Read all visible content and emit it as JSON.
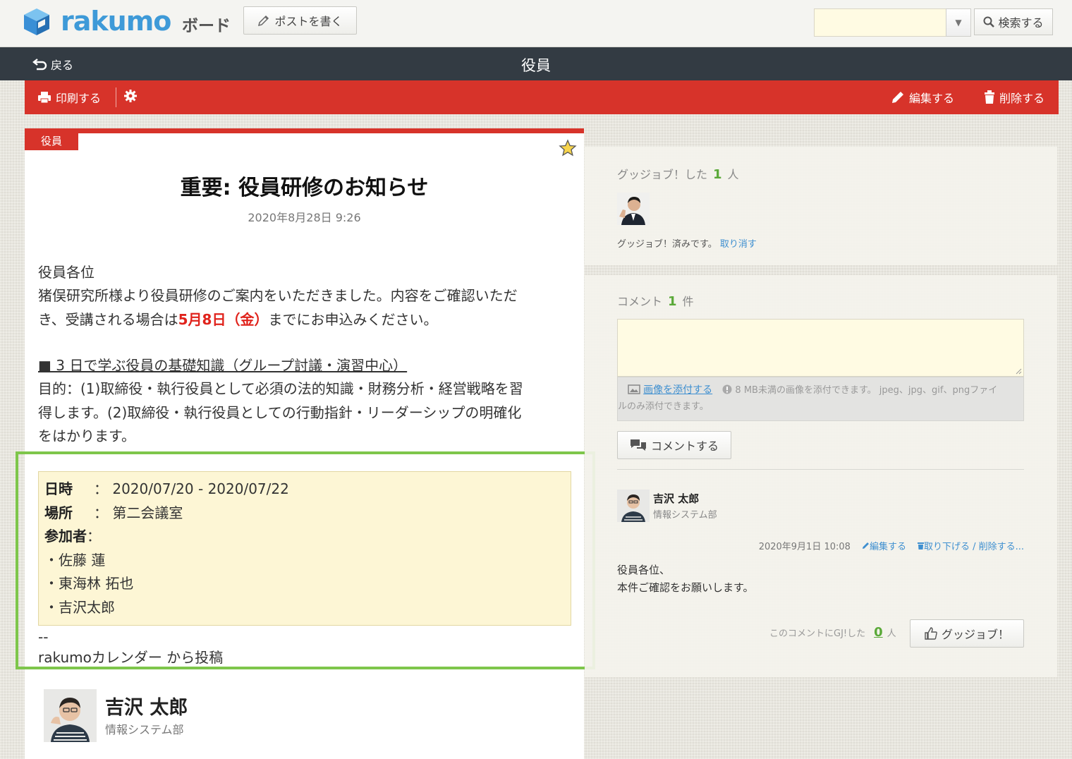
{
  "app": {
    "logo_text": "rakumo",
    "logo_sub": "ボード",
    "brand_color": "#3e9ad8",
    "accent_color": "#d7332a"
  },
  "header": {
    "write_post_label": "ポストを書く",
    "search_value": "",
    "search_label": "検索する"
  },
  "nav": {
    "back_label": "戻る",
    "page_title": "役員"
  },
  "toolbar": {
    "print_label": "印刷する",
    "edit_label": "編集する",
    "delete_label": "削除する"
  },
  "post": {
    "category": "役員",
    "title": "重要: 役員研修のお知らせ",
    "date": "2020年8月28日 9:26",
    "greeting": "役員各位",
    "intro_1": "猪俣研究所様より役員研修のご案内をいただきました。内容をご確認いただ",
    "intro_2a": "き、受講される場合は",
    "deadline": "5月8日（金）",
    "intro_2b": "までにお申込みください。",
    "course_heading": "■ 3 日で学ぶ役員の基礎知識（グループ討議・演習中心）",
    "purpose_1": "目的：(1)取締役・執行役員として必須の法的知識・財務分析・経営戦略を習",
    "purpose_2": "得します。(2)取締役・執行役員としての行動指針・リーダーシップの明確化",
    "purpose_3": "をはかります。",
    "info": {
      "date_label": "日時",
      "date_value": "2020/07/20 - 2020/07/22",
      "place_label": "場所",
      "place_value": "第二会議室",
      "participants_label": "参加者",
      "participants": [
        "・佐藤 蓮",
        "・東海林 拓也",
        "・吉沢太郎"
      ]
    },
    "separator": "--",
    "footer": "rakumoカレンダー から投稿",
    "author_name": "吉沢 太郎",
    "author_dept": "情報システム部"
  },
  "goodjob": {
    "label": "グッジョブ！した",
    "count": "1",
    "unit": "人",
    "status": "グッジョブ！済みです。",
    "cancel_label": "取り消す"
  },
  "comments": {
    "label": "コメント",
    "count": "1",
    "unit": "件",
    "textarea_value": "",
    "attach_label": "画像を添付する",
    "attach_note_1": "8 MB未満の画像を添付できます。 jpeg、jpg、gif、pngファイ",
    "attach_note_2": "ルのみ添付できます。",
    "submit_label": "コメントする",
    "items": [
      {
        "author": "吉沢 太郎",
        "dept": "情報システム部",
        "date": "2020年9月1日 10:08",
        "edit_label": "編集する",
        "delete_label": "取り下げる / 削除する...",
        "line_1": "役員各位、",
        "line_2": "本件ご確認をお願いします。",
        "gj_label": "このコメントにGJ!した",
        "gj_count": "0",
        "gj_unit": "人",
        "gj_button": "グッジョブ！"
      }
    ]
  }
}
